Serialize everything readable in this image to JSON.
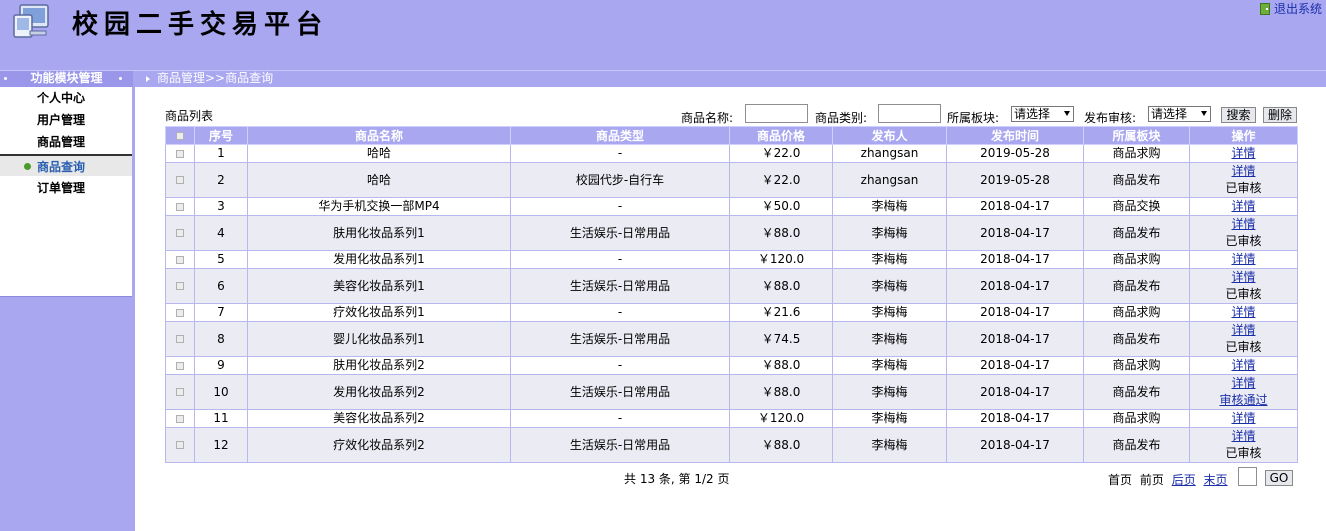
{
  "header": {
    "title": "校园二手交易平台",
    "logout_label": "退出系统"
  },
  "nav": {
    "module_title": "功能模块管理",
    "breadcrumb": "商品管理>>商品查询"
  },
  "sidebar": {
    "items": [
      {
        "label": "个人中心"
      },
      {
        "label": "用户管理"
      },
      {
        "label": "商品管理"
      },
      {
        "label": "商品查询"
      },
      {
        "label": "订单管理"
      }
    ]
  },
  "search": {
    "list_label": "商品列表",
    "name_label": "商品名称:",
    "name_value": "",
    "category_label": "商品类别:",
    "category_value": "",
    "section_label": "所属板块:",
    "section_value": "请选择",
    "review_label": "发布审核:",
    "review_value": "请选择",
    "search_button": "搜索",
    "delete_button": "删除"
  },
  "table": {
    "columns": [
      "序号",
      "商品名称",
      "商品类型",
      "商品价格",
      "发布人",
      "发布时间",
      "所属板块",
      "操作"
    ],
    "rows": [
      {
        "no": "1",
        "name": "哈哈",
        "type": "-",
        "price": "￥22.0",
        "publisher": "zhangsan",
        "date": "2019-05-28",
        "section": "商品求购",
        "action": "详情",
        "status": ""
      },
      {
        "no": "2",
        "name": "哈哈",
        "type": "校园代步-自行车",
        "price": "￥22.0",
        "publisher": "zhangsan",
        "date": "2019-05-28",
        "section": "商品发布",
        "action": "详情",
        "status": "已审核"
      },
      {
        "no": "3",
        "name": "华为手机交换一部MP4",
        "type": "-",
        "price": "￥50.0",
        "publisher": "李梅梅",
        "date": "2018-04-17",
        "section": "商品交换",
        "action": "详情",
        "status": ""
      },
      {
        "no": "4",
        "name": "肤用化妆品系列1",
        "type": "生活娱乐-日常用品",
        "price": "￥88.0",
        "publisher": "李梅梅",
        "date": "2018-04-17",
        "section": "商品发布",
        "action": "详情",
        "status": "已审核"
      },
      {
        "no": "5",
        "name": "发用化妆品系列1",
        "type": "-",
        "price": "￥120.0",
        "publisher": "李梅梅",
        "date": "2018-04-17",
        "section": "商品求购",
        "action": "详情",
        "status": ""
      },
      {
        "no": "6",
        "name": "美容化妆品系列1",
        "type": "生活娱乐-日常用品",
        "price": "￥88.0",
        "publisher": "李梅梅",
        "date": "2018-04-17",
        "section": "商品发布",
        "action": "详情",
        "status": "已审核"
      },
      {
        "no": "7",
        "name": "疗效化妆品系列1",
        "type": "-",
        "price": "￥21.6",
        "publisher": "李梅梅",
        "date": "2018-04-17",
        "section": "商品求购",
        "action": "详情",
        "status": ""
      },
      {
        "no": "8",
        "name": "婴儿化妆品系列1",
        "type": "生活娱乐-日常用品",
        "price": "￥74.5",
        "publisher": "李梅梅",
        "date": "2018-04-17",
        "section": "商品发布",
        "action": "详情",
        "status": "已审核"
      },
      {
        "no": "9",
        "name": "肤用化妆品系列2",
        "type": "-",
        "price": "￥88.0",
        "publisher": "李梅梅",
        "date": "2018-04-17",
        "section": "商品求购",
        "action": "详情",
        "status": ""
      },
      {
        "no": "10",
        "name": "发用化妆品系列2",
        "type": "生活娱乐-日常用品",
        "price": "￥88.0",
        "publisher": "李梅梅",
        "date": "2018-04-17",
        "section": "商品发布",
        "action": "详情",
        "status": "审核通过"
      },
      {
        "no": "11",
        "name": "美容化妆品系列2",
        "type": "-",
        "price": "￥120.0",
        "publisher": "李梅梅",
        "date": "2018-04-17",
        "section": "商品求购",
        "action": "详情",
        "status": ""
      },
      {
        "no": "12",
        "name": "疗效化妆品系列2",
        "type": "生活娱乐-日常用品",
        "price": "￥88.0",
        "publisher": "李梅梅",
        "date": "2018-04-17",
        "section": "商品发布",
        "action": "详情",
        "status": "已审核"
      }
    ]
  },
  "pager": {
    "summary": "共 13 条, 第 1/2 页",
    "first": "首页",
    "prev": "前页",
    "next": "后页",
    "last": "末页",
    "page_value": "",
    "go_label": "GO"
  },
  "colors": {
    "theme": "#a9a7f0",
    "row_alt": "#ebebf4",
    "link": "#1a2fa8"
  }
}
